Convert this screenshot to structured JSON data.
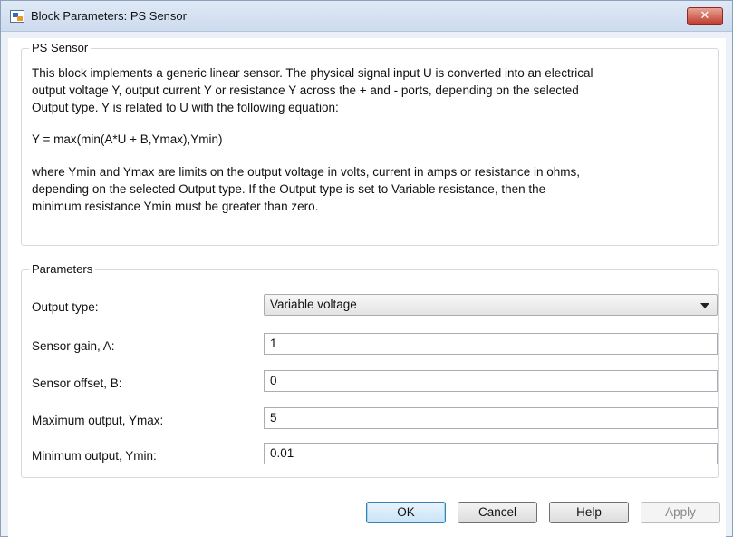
{
  "window": {
    "title": "Block Parameters: PS Sensor",
    "close_label": "✕"
  },
  "description_group": {
    "title": "PS Sensor",
    "paragraph1_line1": "This block implements a generic linear sensor. The physical signal input U is converted into an electrical",
    "paragraph1_line2": "output voltage Y, output current Y or resistance Y across the + and - ports, depending on the selected",
    "paragraph1_line3": "Output type. Y is related to U with the following equation:",
    "equation": "Y = max(min(A*U + B,Ymax),Ymin)",
    "paragraph2_line1": "where Ymin and Ymax are limits on the output voltage in volts, current in amps or resistance in ohms,",
    "paragraph2_line2": "depending on the selected Output type. If the Output type is set to Variable resistance, then the",
    "paragraph2_line3": "minimum resistance Ymin must be greater than zero."
  },
  "parameters_group": {
    "title": "Parameters",
    "output_type": {
      "label": "Output type:",
      "value": "Variable voltage"
    },
    "sensor_gain": {
      "label": "Sensor gain, A:",
      "value": "1"
    },
    "sensor_offset": {
      "label": "Sensor offset, B:",
      "value": "0"
    },
    "max_output": {
      "label": "Maximum output, Ymax:",
      "value": "5"
    },
    "min_output": {
      "label": "Minimum output, Ymin:",
      "value": "0.01"
    }
  },
  "buttons": {
    "ok": "OK",
    "cancel": "Cancel",
    "help": "Help",
    "apply": "Apply"
  }
}
